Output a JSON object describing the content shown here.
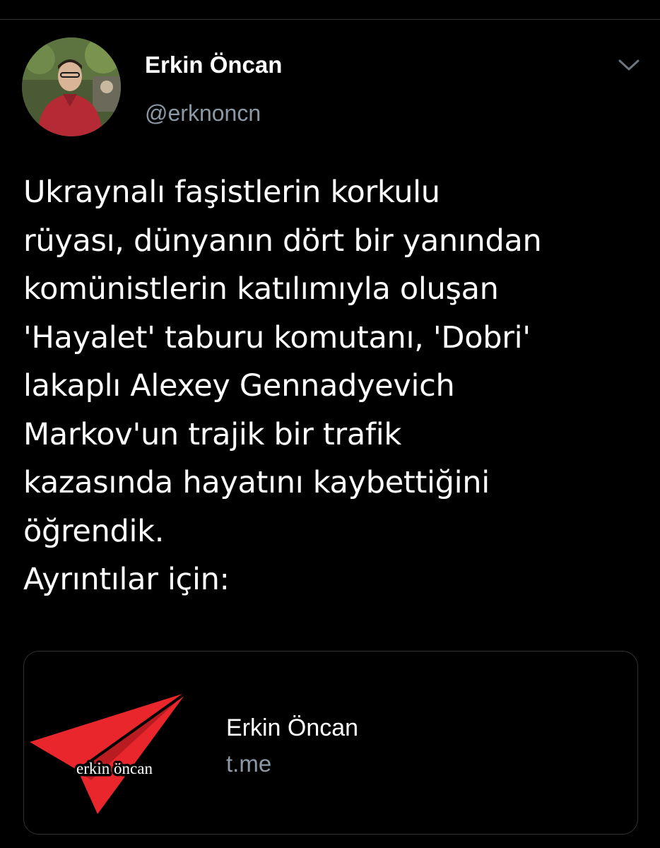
{
  "colors": {
    "background": "#000000",
    "primary_text": "#ffffff",
    "secondary_text": "#8b98a5",
    "border": "#2f3336",
    "logo_red": "#e8262b"
  },
  "author": {
    "name": "Erkin Öncan",
    "handle": "@erknoncn",
    "avatar_icon": "user-avatar-photo"
  },
  "menu": {
    "icon": "chevron-down-icon"
  },
  "tweet": {
    "lines": [
      "Ukraynalı faşistlerin korkulu",
      "rüyası, dünyanın dört bir yanından",
      "komünistlerin katılımıyla oluşan",
      "'Hayalet' taburu komutanı, 'Dobri'",
      "lakaplı Alexey Gennadyevich",
      "Markov'un trajik bir trafik",
      "kazasında hayatını kaybettiğini",
      "öğrendik.",
      "Ayrıntılar için:"
    ]
  },
  "link_card": {
    "thumbnail_icon": "paper-plane-logo",
    "thumbnail_caption": "erkin öncan",
    "title": "Erkin Öncan",
    "domain": "t.me"
  }
}
